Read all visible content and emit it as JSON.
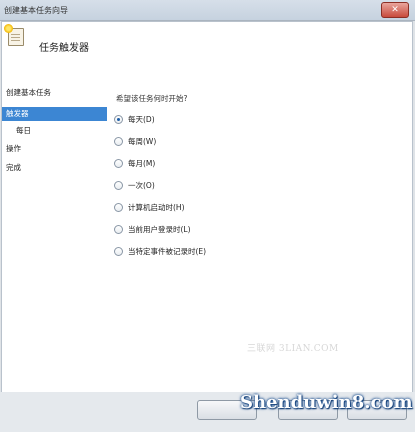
{
  "window": {
    "title": "创建基本任务向导",
    "close_glyph": "✕"
  },
  "header": {
    "title": "任务触发器",
    "icon": "task-scheduler-icon"
  },
  "sidebar": {
    "items": [
      {
        "label": "创建基本任务"
      },
      {
        "label": "触发器"
      },
      {
        "label": "每日"
      },
      {
        "label": "操作"
      },
      {
        "label": "完成"
      }
    ]
  },
  "main": {
    "question": "希望该任务何时开始?",
    "options": [
      {
        "label": "每天(D)",
        "checked": true
      },
      {
        "label": "每周(W)",
        "checked": false
      },
      {
        "label": "每月(M)",
        "checked": false
      },
      {
        "label": "一次(O)",
        "checked": false
      },
      {
        "label": "计算机启动时(H)",
        "checked": false
      },
      {
        "label": "当前用户登录时(L)",
        "checked": false
      },
      {
        "label": "当特定事件被记录时(E)",
        "checked": false
      }
    ]
  },
  "watermarks": {
    "site": "三联网 3LIAN.COM",
    "brand": "Shenduwin8.com"
  },
  "colors": {
    "selection": "#3c86d3",
    "window_bg": "#dfe3e7",
    "client_bg": "#ffffff"
  }
}
